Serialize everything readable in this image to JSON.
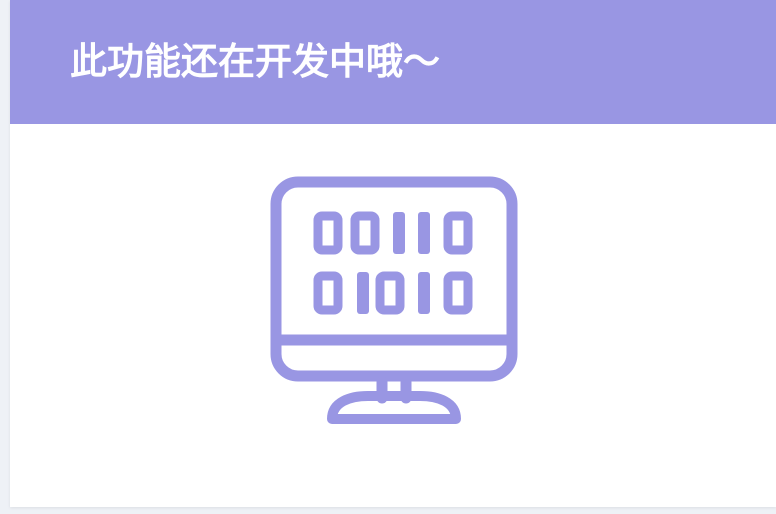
{
  "dialog": {
    "title": "此功能还在开发中哦～",
    "illustration_icon": "computer-monitor-binary-icon"
  },
  "colors": {
    "accent": "#9996e3",
    "background": "#ffffff",
    "page_background": "#eef1f6",
    "title_text": "#ffffff"
  }
}
